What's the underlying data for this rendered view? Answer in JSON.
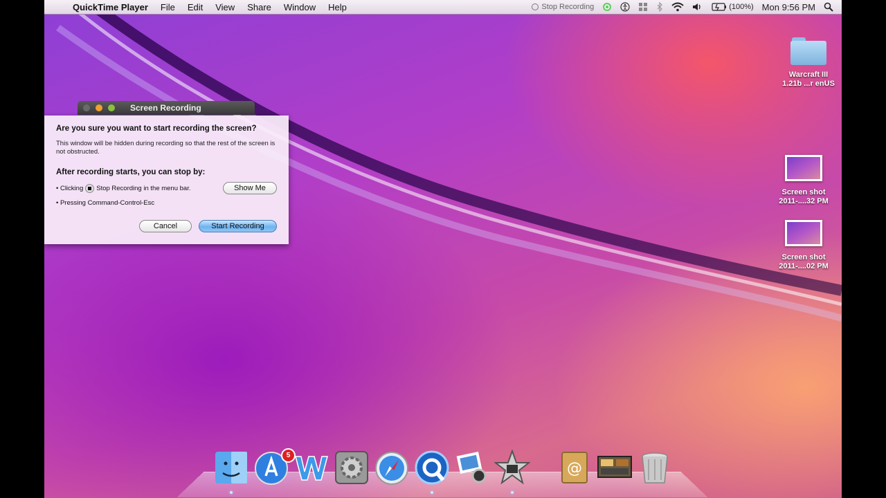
{
  "menubar": {
    "app_name": "QuickTime Player",
    "menus": [
      "File",
      "Edit",
      "View",
      "Share",
      "Window",
      "Help"
    ],
    "status_stop_recording": "Stop Recording",
    "battery": "(100%)",
    "clock": "Mon 9:56 PM"
  },
  "desktop": {
    "icons": [
      {
        "line1": "Warcraft III",
        "line2": "1.21b ...r enUS"
      },
      {
        "line1": "Screen shot",
        "line2": "2011-....32 PM"
      },
      {
        "line1": "Screen shot",
        "line2": "2011-....02 PM"
      }
    ]
  },
  "window": {
    "title": "Screen Recording",
    "question": "Are you sure you want to start recording the screen?",
    "description": "This window will be hidden during recording so that the rest of the screen is not obstructed.",
    "after_heading": "After recording starts, you can stop by:",
    "bullet1_prefix": "• Clicking",
    "bullet1_suffix": "Stop Recording in the menu bar.",
    "show_me": "Show Me",
    "bullet2": "• Pressing Command-Control-Esc",
    "cancel": "Cancel",
    "start_recording": "Start Recording"
  },
  "dock": {
    "app_store_badge": "5",
    "items": [
      "finder",
      "app-store",
      "word",
      "system-preferences",
      "safari",
      "quicktime",
      "iphoto",
      "imovie",
      "address-book",
      "photo-booth",
      "trash"
    ]
  }
}
